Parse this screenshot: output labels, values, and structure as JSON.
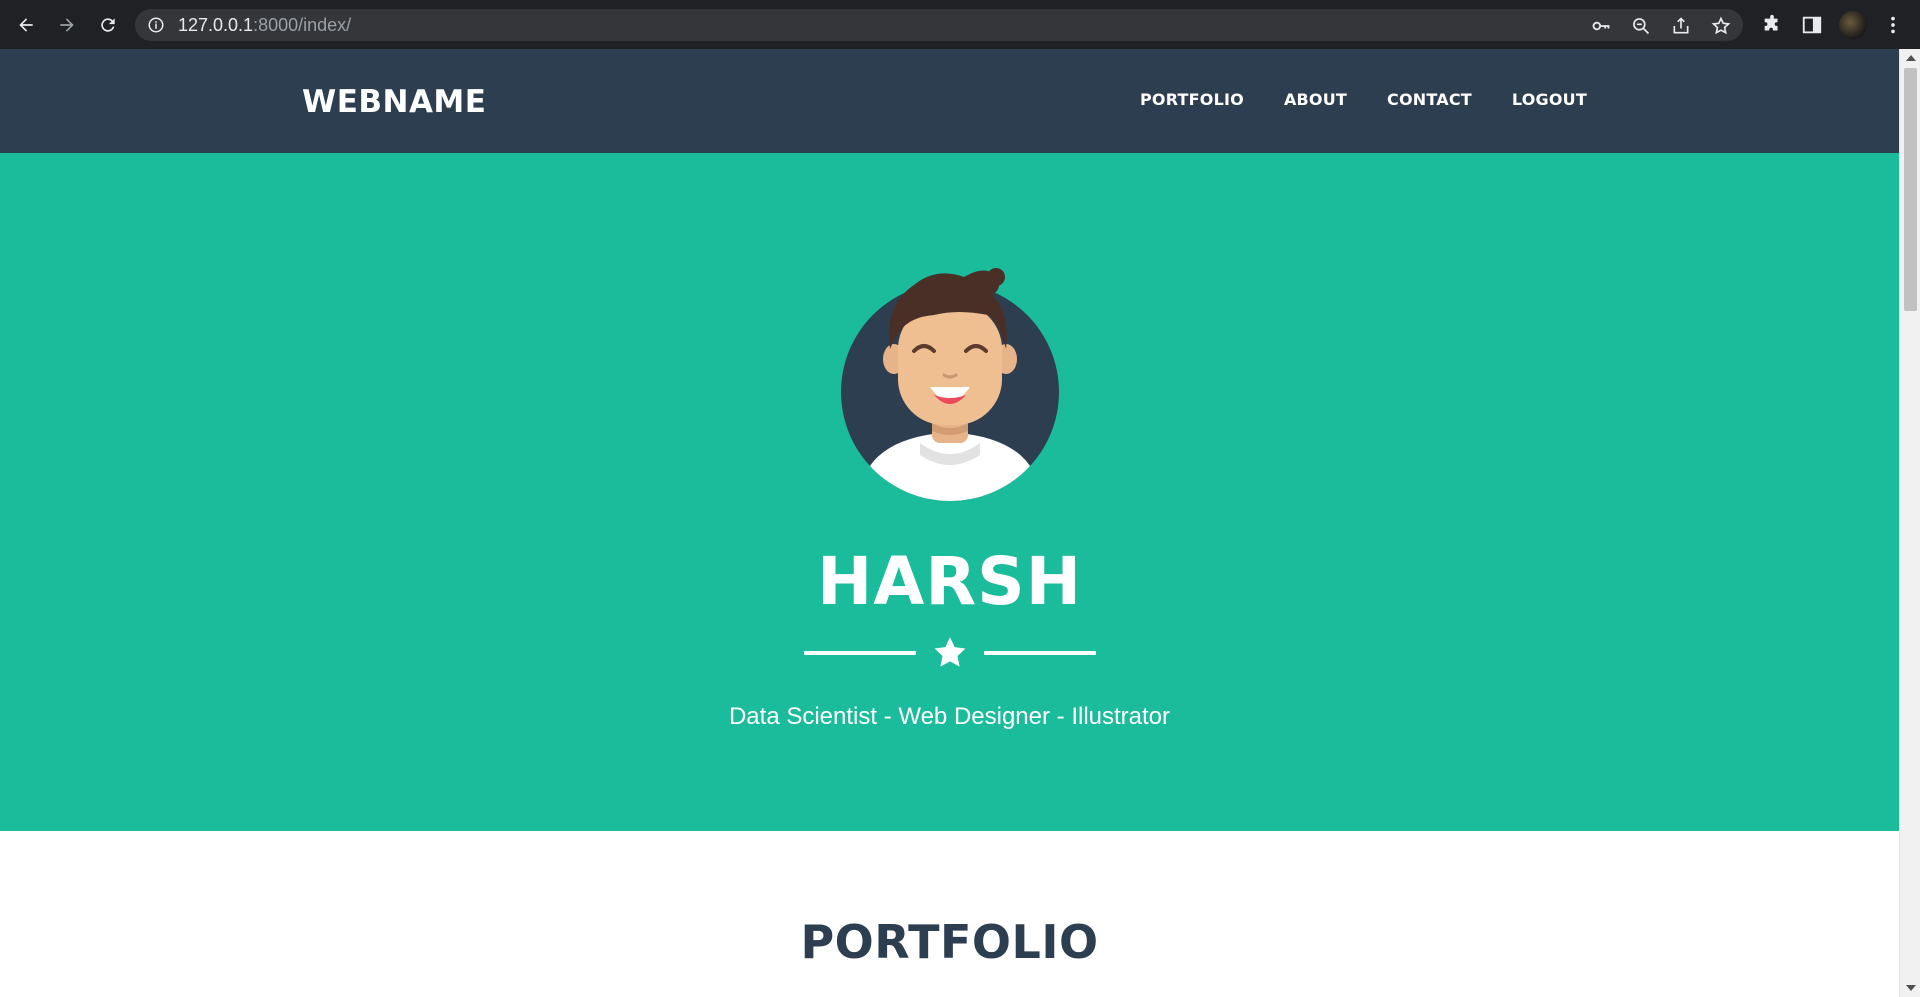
{
  "browser": {
    "url_host": "127.0.0.1",
    "url_path": ":8000/index/",
    "icons": [
      "back-icon",
      "forward-icon",
      "reload-icon",
      "info-icon",
      "key-icon",
      "zoom-out-icon",
      "share-icon",
      "star-icon",
      "extensions-icon",
      "side-panel-icon",
      "profile-avatar",
      "menu-icon"
    ]
  },
  "navbar": {
    "brand": "WEBNAME",
    "links": [
      "PORTFOLIO",
      "ABOUT",
      "CONTACT",
      "LOGOUT"
    ]
  },
  "hero": {
    "name": "HARSH",
    "subtitle": "Data Scientist - Web Designer - Illustrator",
    "divider_icon": "star-icon"
  },
  "portfolio": {
    "title": "PORTFOLIO"
  },
  "colors": {
    "navbar_bg": "#2c3e50",
    "hero_bg": "#1abc9c",
    "heading": "#2c3e50"
  }
}
